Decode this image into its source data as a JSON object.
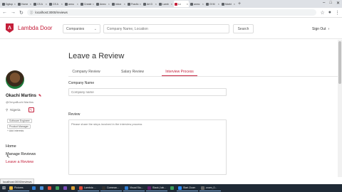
{
  "browser": {
    "tabs": [
      {
        "label": "Dgitop"
      },
      {
        "label": "Home"
      },
      {
        "label": "CS A"
      },
      {
        "label": "CS A"
      },
      {
        "label": "annu"
      },
      {
        "label": "Create"
      },
      {
        "label": "Anmc"
      },
      {
        "label": "inbox"
      },
      {
        "label": "Fractic"
      },
      {
        "label": "Art D"
      },
      {
        "label": "Lamb"
      },
      {
        "label": "Lx",
        "active": true
      },
      {
        "label": "anmc"
      },
      {
        "label": "Gf M"
      },
      {
        "label": "Markt"
      }
    ],
    "url": "localhost:3000/reviews",
    "new_tab": "+"
  },
  "header": {
    "brand": "Lambda Door",
    "brand_color": "#c41f3a",
    "companies_select": "Companies",
    "search_placeholder": "Company Name, Location",
    "search_button": "Search",
    "sign_out": "Sign Out"
  },
  "sidebar": {
    "name": "Okachi Martins",
    "handle": "@OmyaBuchi Martins",
    "location": "Nigeria",
    "interests": [
      "Software Engineer",
      "Product Manager"
    ],
    "add_interests": "+ Add interests",
    "nav": [
      {
        "label": "Home"
      },
      {
        "label": "Manage Reviews"
      },
      {
        "label": "Leave a Review",
        "active": true
      }
    ]
  },
  "main": {
    "title": "Leave a Review",
    "tabs": [
      {
        "label": "Company Review"
      },
      {
        "label": "Salary Review"
      },
      {
        "label": "Interview Process",
        "active": true
      }
    ],
    "company_label": "Company Name",
    "company_placeholder": "Company name",
    "review_label": "Review",
    "review_placeholder": "Please share the steps involved in the interview process"
  },
  "status_bar": "localhost:3000/reviews",
  "taskbar": {
    "items": [
      {
        "label": "Pictures",
        "color": "#e8b53b"
      },
      {
        "label": "",
        "color": "#2e7bcf"
      },
      {
        "label": "",
        "color": "#4a90d9"
      },
      {
        "label": "",
        "color": "#e04b3a"
      },
      {
        "label": "",
        "color": "#3b9e5a"
      },
      {
        "label": "",
        "color": "#7c4dbd"
      },
      {
        "label": "",
        "color": "#d9a23a"
      },
      {
        "label": "Lambda ...",
        "color": "#e04b3a"
      },
      {
        "label": "Comman...",
        "color": "#333333"
      },
      {
        "label": "Visual Stu...",
        "color": "#2e7bcf"
      },
      {
        "label": "Slack | lab...",
        "color": "#611f69"
      },
      {
        "label": "",
        "color": "#3b9e5a"
      },
      {
        "label": "Start Zoom",
        "color": "#2d8cff"
      },
      {
        "label": "zoom_0...",
        "color": "#666666"
      }
    ],
    "time": "4:48 PM",
    "date": "6/1/2020"
  }
}
